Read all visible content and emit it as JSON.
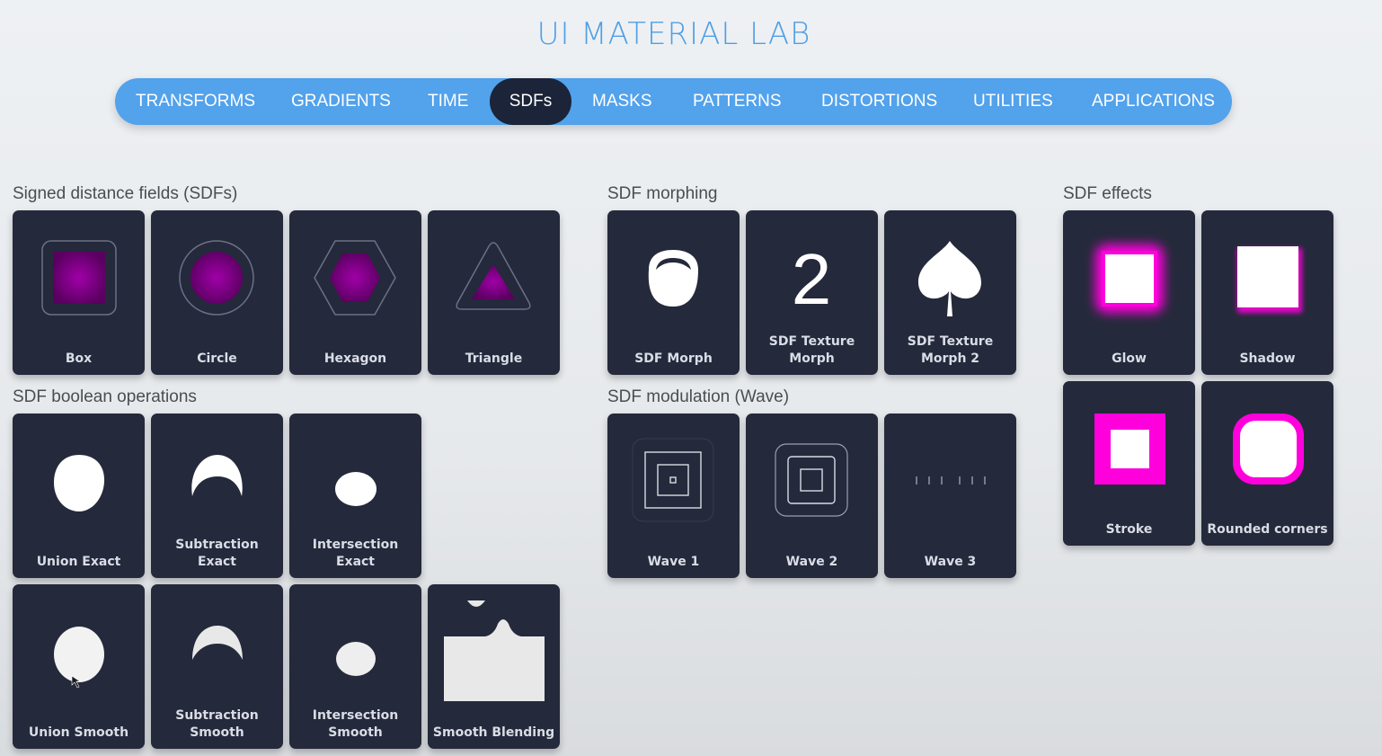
{
  "app": {
    "title": "UI MATERIAL LAB"
  },
  "nav": {
    "tabs": [
      {
        "label": "TRANSFORMS"
      },
      {
        "label": "GRADIENTS"
      },
      {
        "label": "TIME"
      },
      {
        "label": "SDFs",
        "active": true
      },
      {
        "label": "MASKS"
      },
      {
        "label": "PATTERNS"
      },
      {
        "label": "DISTORTIONS"
      },
      {
        "label": "UTILITIES"
      },
      {
        "label": "APPLICATIONS"
      }
    ]
  },
  "sections": {
    "sdfs": {
      "title": "Signed distance fields (SDFs)",
      "tiles": [
        {
          "label": "Box",
          "icon": "box-sdf-icon"
        },
        {
          "label": "Circle",
          "icon": "circle-sdf-icon"
        },
        {
          "label": "Hexagon",
          "icon": "hexagon-sdf-icon"
        },
        {
          "label": "Triangle",
          "icon": "triangle-sdf-icon"
        }
      ]
    },
    "boolean": {
      "title": "SDF boolean operations",
      "tiles": [
        {
          "label": "Union Exact",
          "icon": "union-exact-icon"
        },
        {
          "label": "Subtraction\nExact",
          "icon": "subtraction-exact-icon"
        },
        {
          "label": "Intersection\nExact",
          "icon": "intersection-exact-icon"
        },
        {
          "label": "Union Smooth",
          "icon": "union-smooth-icon"
        },
        {
          "label": "Subtraction\nSmooth",
          "icon": "subtraction-smooth-icon"
        },
        {
          "label": "Intersection\nSmooth",
          "icon": "intersection-smooth-icon"
        },
        {
          "label": "Smooth Blending",
          "icon": "smooth-blending-icon"
        }
      ]
    },
    "morphing": {
      "title": "SDF morphing",
      "tiles": [
        {
          "label": "SDF Morph",
          "icon": "sdf-morph-icon"
        },
        {
          "label": "SDF Texture\nMorph",
          "icon": "digit-two-icon",
          "glyph": "2"
        },
        {
          "label": "SDF Texture\nMorph 2",
          "icon": "spade-icon"
        }
      ]
    },
    "modulation": {
      "title": "SDF modulation (Wave)",
      "tiles": [
        {
          "label": "Wave 1",
          "icon": "wave-square-icon"
        },
        {
          "label": "Wave 2",
          "icon": "wave-square-icon"
        },
        {
          "label": "Wave 3",
          "icon": "wave-ticks-icon"
        }
      ]
    },
    "effects": {
      "title": "SDF effects",
      "tiles": [
        {
          "label": "Glow",
          "icon": "glow-square-icon"
        },
        {
          "label": "Shadow",
          "icon": "shadow-square-icon"
        },
        {
          "label": "Stroke",
          "icon": "stroke-square-icon"
        },
        {
          "label": "Rounded corners",
          "icon": "rounded-square-icon"
        }
      ]
    }
  },
  "colors": {
    "accent": "#52a2ec",
    "title": "#4f9fe3",
    "tile_bg": "#24293b",
    "active_tab": "#1b2438",
    "magenta": "#ff00dd",
    "purple": "#8a008f"
  }
}
